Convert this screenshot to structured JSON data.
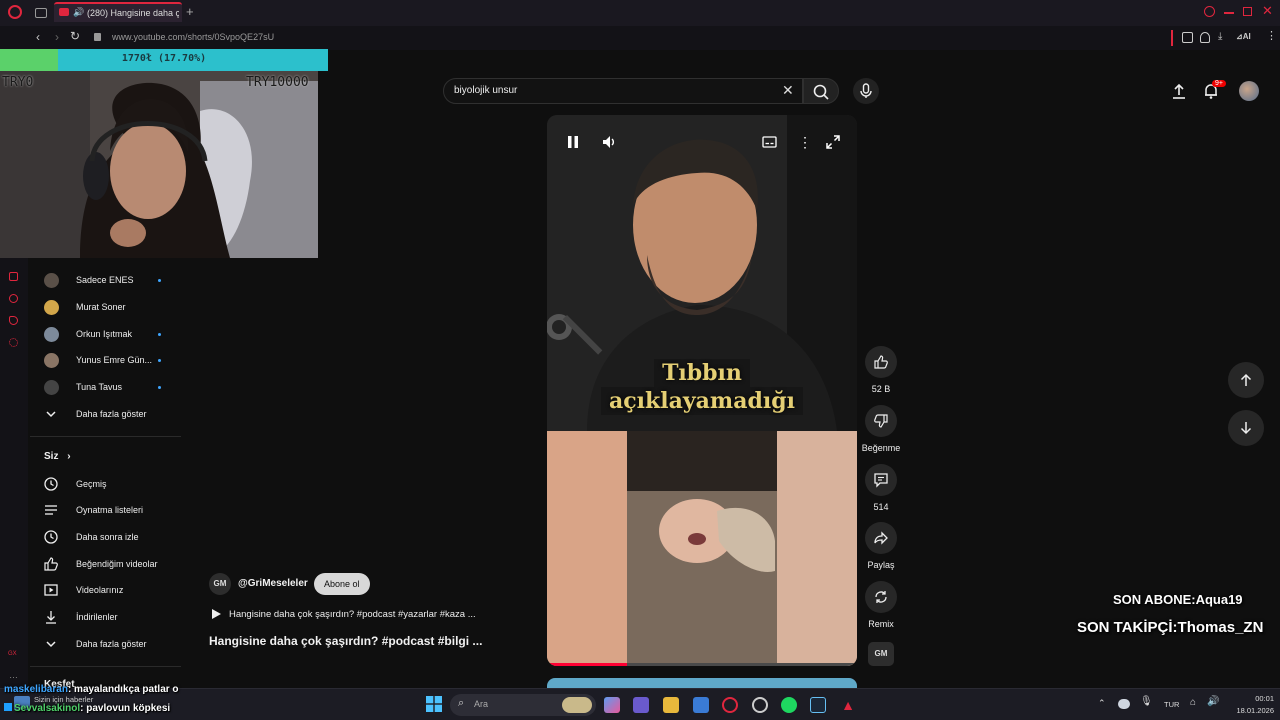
{
  "browser": {
    "tab_title": "(280) Hangisine daha ç",
    "url": "www.youtube.com/shorts/0SvpoQE27sU",
    "ai_label": "AI"
  },
  "header": {
    "search_value": "biyolojik unsur",
    "notification_count": "9+"
  },
  "sidebar": {
    "subscriptions": [
      {
        "label": "Sadece ENES",
        "new": true
      },
      {
        "label": "Murat Soner",
        "new": false
      },
      {
        "label": "Orkun Işıtmak",
        "new": true
      },
      {
        "label": "Yunus Emre Gün...",
        "new": true
      },
      {
        "label": "Tuna Tavus",
        "new": true
      }
    ],
    "show_more_1": "Daha fazla göster",
    "you_header": "Siz",
    "you_items": [
      {
        "label": "Geçmiş",
        "icon": "history-icon"
      },
      {
        "label": "Oynatma listeleri",
        "icon": "playlist-icon"
      },
      {
        "label": "Daha sonra izle",
        "icon": "clock-icon"
      },
      {
        "label": "Beğendiğim videolar",
        "icon": "like-icon"
      },
      {
        "label": "Videolarınız",
        "icon": "video-icon"
      },
      {
        "label": "İndirilenler",
        "icon": "download-icon"
      }
    ],
    "show_more_2": "Daha fazla göster",
    "explore_header": "Keşfet"
  },
  "video": {
    "caption_line1": "Tıbbın",
    "caption_line2": "açıklayamadığı",
    "channel_badge": "GM",
    "channel_name": "@GriMeseleler",
    "subscribe_label": "Abone ol",
    "playlist_line": "Hangisine daha çok şaşırdın? #podcast #yazarlar #kaza ...",
    "title": "Hangisine daha çok şaşırdın? #podcast #bilgi ..."
  },
  "actions": {
    "likes": "52 B",
    "dislike_label": "Beğenme",
    "comments": "514",
    "share_label": "Paylaş",
    "remix_label": "Remix"
  },
  "overlay": {
    "progress_text": "1770ł (17.70%)",
    "progress_fraction": 0.177,
    "goal_left": "TRY0",
    "goal_right": "TRY10000",
    "last_sub": "SON ABONE:Aqua19",
    "last_follower": "SON TAKİPÇİ:Thomas_ZN",
    "chat": [
      {
        "user": "maskelibaran",
        "text": ": mayalandıkça patlar o",
        "user_color": "#3ea6ff"
      },
      {
        "user": "Sevvalsakinol",
        "text": ": pavlovun köpkesi",
        "user_color": "#4fd16a"
      }
    ]
  },
  "taskbar": {
    "search_placeholder": "Ara",
    "news": "Sizin için haberler",
    "lang": "TUR",
    "time": "00:01",
    "date": "18.01.2026"
  }
}
